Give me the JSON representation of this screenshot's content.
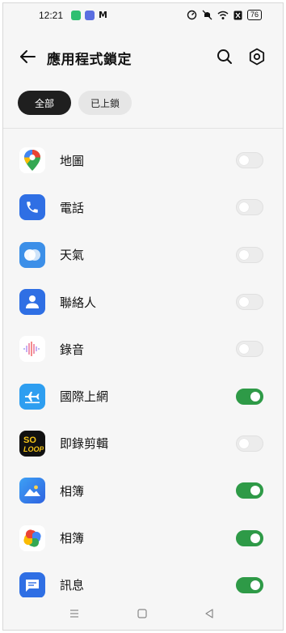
{
  "status_bar": {
    "time": "12:21",
    "battery": "76"
  },
  "header": {
    "title": "應用程式鎖定"
  },
  "tabs": [
    {
      "label": "全部",
      "active": true
    },
    {
      "label": "已上鎖",
      "active": false
    }
  ],
  "apps": [
    {
      "name": "地圖",
      "icon": "google-maps-icon",
      "locked": false
    },
    {
      "name": "電話",
      "icon": "phone-icon",
      "locked": false
    },
    {
      "name": "天氣",
      "icon": "weather-icon",
      "locked": false
    },
    {
      "name": "聯絡人",
      "icon": "contacts-icon",
      "locked": false
    },
    {
      "name": "錄音",
      "icon": "recorder-icon",
      "locked": false
    },
    {
      "name": "國際上網",
      "icon": "airplane-icon",
      "locked": true
    },
    {
      "name": "即錄剪輯",
      "icon": "soloop-icon",
      "locked": false
    },
    {
      "name": "相簿",
      "icon": "gallery-icon",
      "locked": true
    },
    {
      "name": "相簿",
      "icon": "google-photos-icon",
      "locked": true
    },
    {
      "name": "訊息",
      "icon": "messages-icon",
      "locked": true
    }
  ],
  "colors": {
    "toggle_on": "#2e9a47",
    "toggle_off": "#ececec",
    "tab_active_bg": "#1f1f1f"
  }
}
